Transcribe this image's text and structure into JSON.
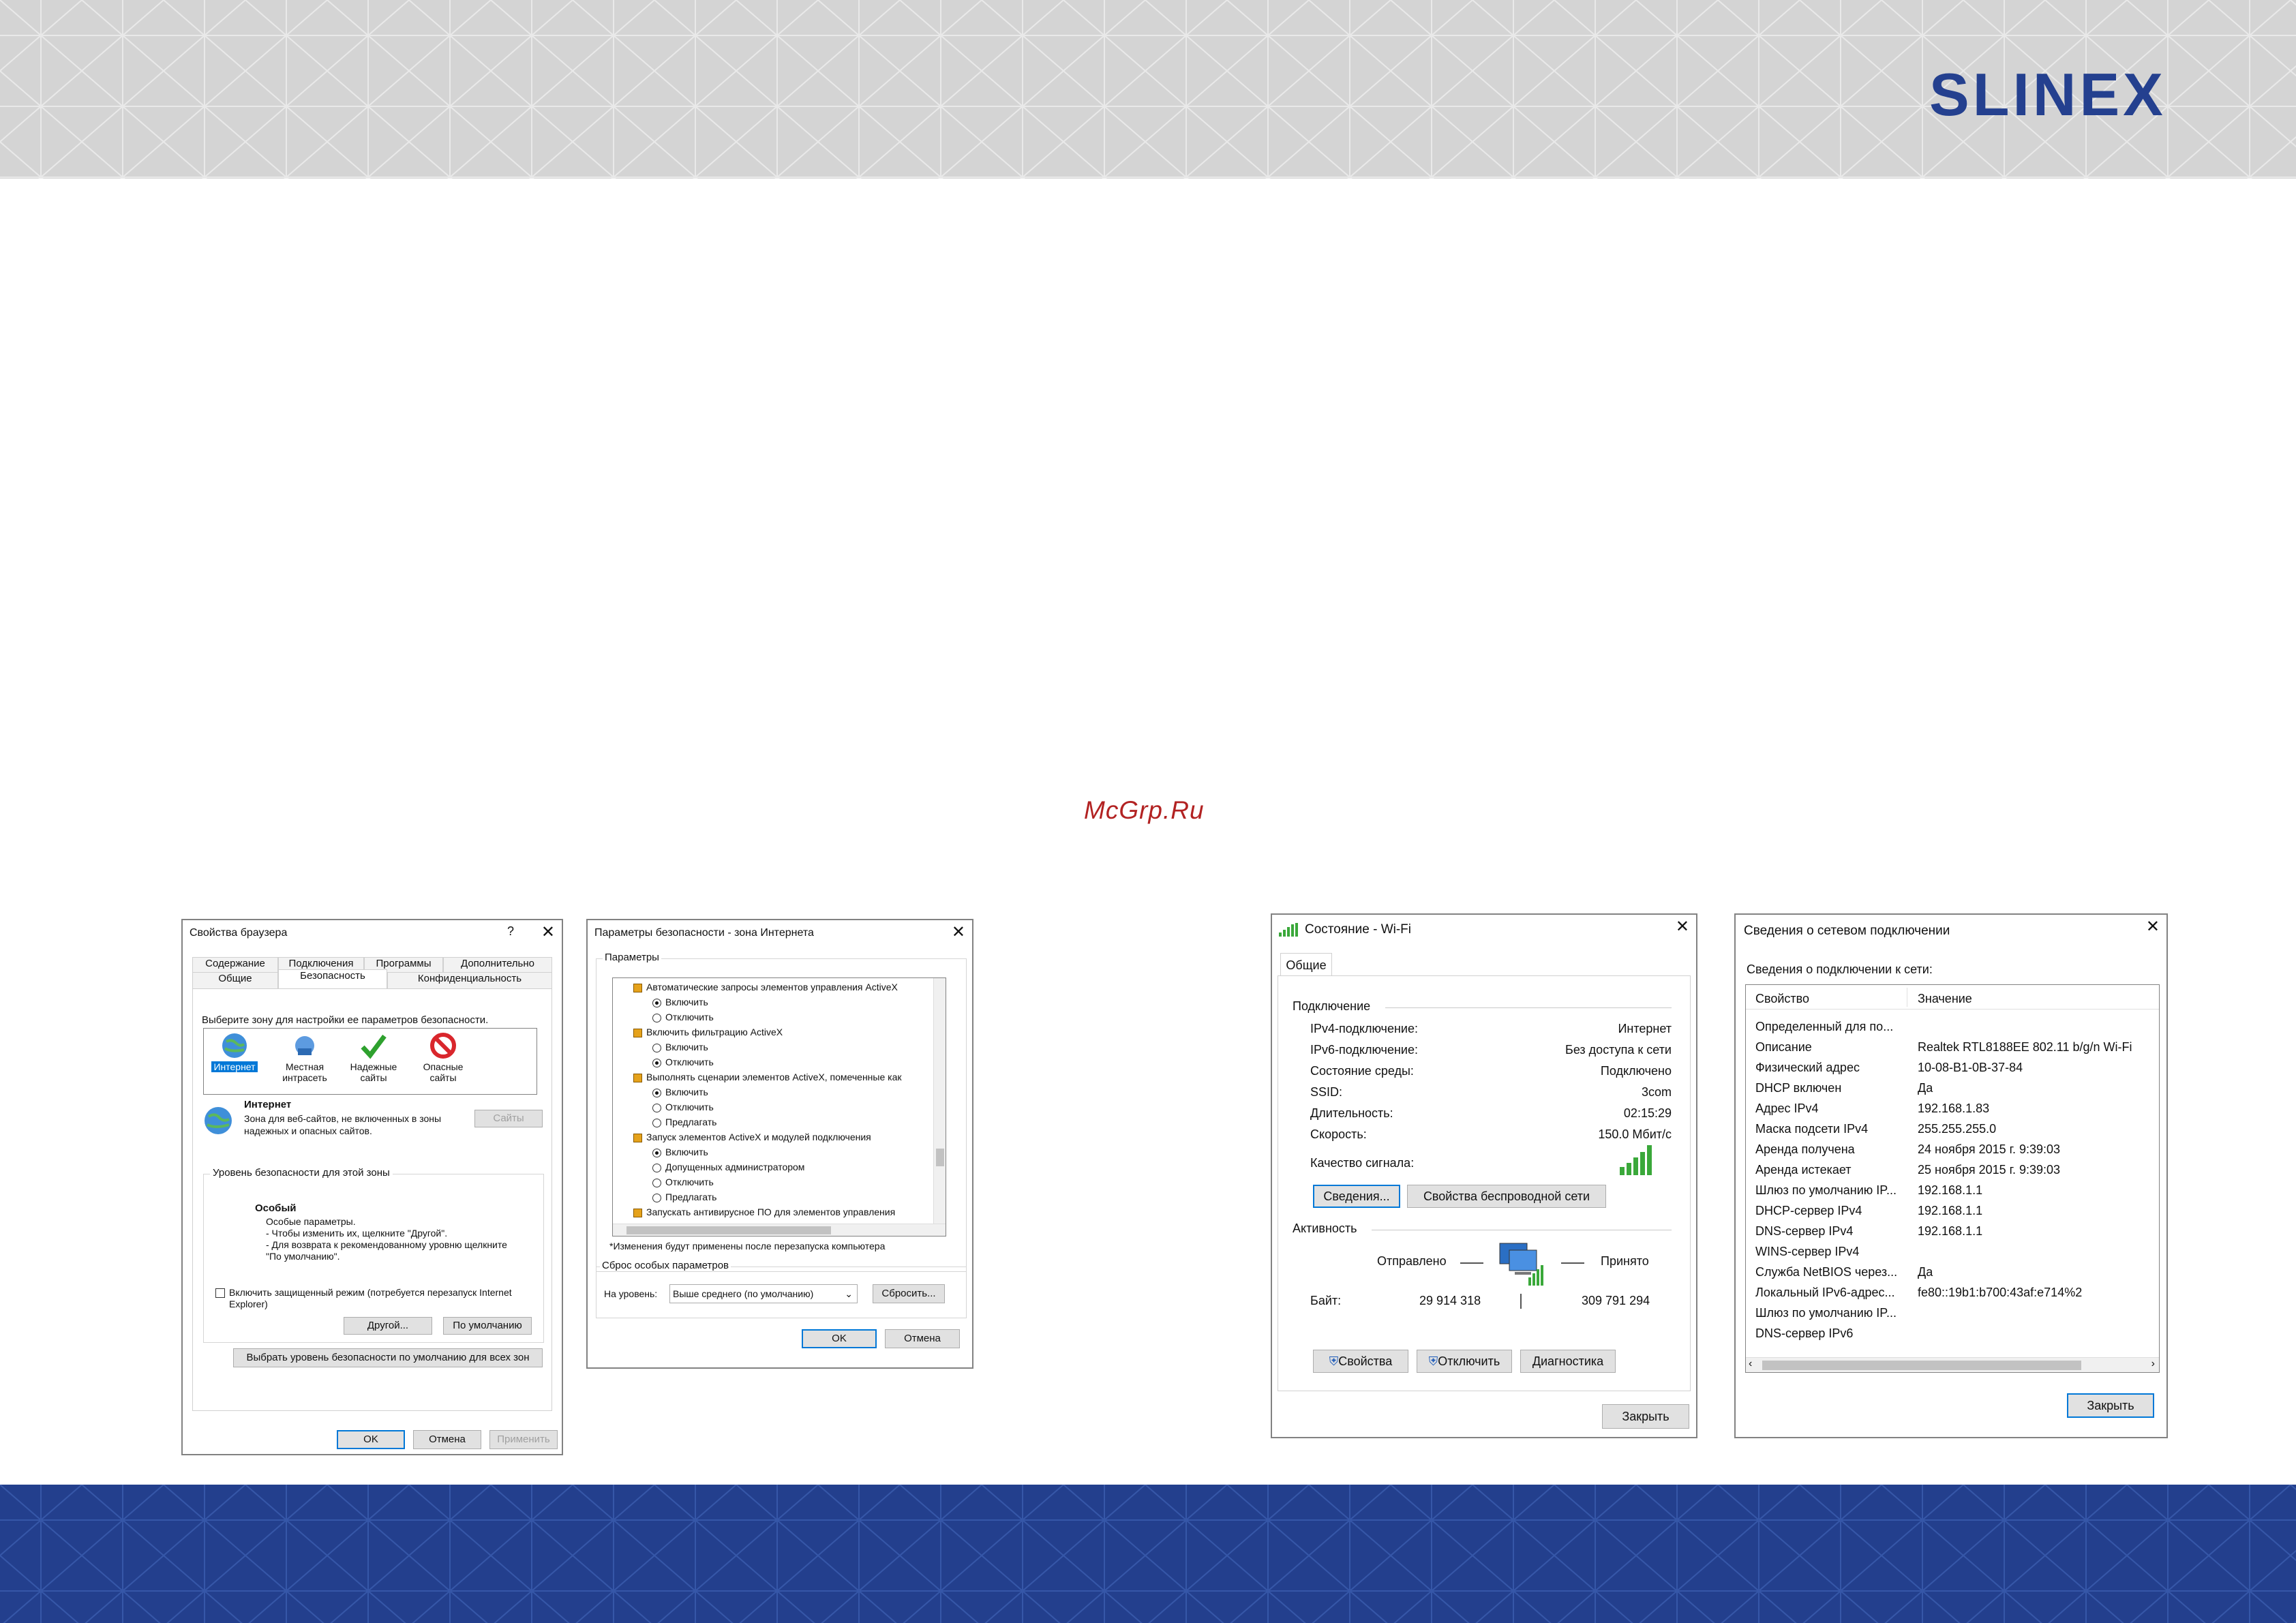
{
  "brand": {
    "logo": "SLINEX",
    "watermark": "McGrp.Ru"
  },
  "win1": {
    "title": "Свойства браузера",
    "help": "?",
    "close": "✕",
    "tabs_top": [
      "Содержание",
      "Подключения",
      "Программы",
      "Дополнительно"
    ],
    "tabs_bottom": [
      "Общие",
      "Безопасность",
      "Конфиденциальность"
    ],
    "zone_prompt": "Выберите зону для настройки ее параметров безопасности.",
    "zones": [
      {
        "label": "Интернет"
      },
      {
        "label": "Местная интрасеть"
      },
      {
        "label": "Надежные сайты"
      },
      {
        "label": "Опасные сайты"
      }
    ],
    "zone_title": "Интернет",
    "zone_desc": "Зона для веб-сайтов, не включенных в зоны надежных и опасных сайтов.",
    "sites_btn": "Сайты",
    "level_group": "Уровень безопасности для этой зоны",
    "level_name": "Особый",
    "level_desc": [
      "Особые параметры.",
      "- Чтобы изменить их, щелкните \"Другой\".",
      "- Для возврата к рекомендованному уровню щелкните \"По умолчанию\"."
    ],
    "protected_mode": "Включить защищенный режим (потребуется перезапуск Internet Explorer)",
    "other_btn": "Другой...",
    "default_btn": "По умолчанию",
    "all_zones_btn": "Выбрать уровень безопасности по умолчанию для всех зон",
    "ok": "OK",
    "cancel": "Отмена",
    "apply": "Применить"
  },
  "win2": {
    "title": "Параметры безопасности - зона Интернета",
    "close": "✕",
    "params": "Параметры",
    "items": [
      {
        "kind": "cat",
        "text": "Автоматические запросы элементов управления ActiveX"
      },
      {
        "kind": "radio",
        "on": true,
        "text": "Включить"
      },
      {
        "kind": "radio",
        "on": false,
        "text": "Отключить"
      },
      {
        "kind": "cat",
        "text": "Включить фильтрацию ActiveX"
      },
      {
        "kind": "radio",
        "on": false,
        "text": "Включить"
      },
      {
        "kind": "radio",
        "on": true,
        "text": "Отключить"
      },
      {
        "kind": "cat",
        "text": "Выполнять сценарии элементов ActiveX, помеченные как"
      },
      {
        "kind": "radio",
        "on": true,
        "text": "Включить"
      },
      {
        "kind": "radio",
        "on": false,
        "text": "Отключить"
      },
      {
        "kind": "radio",
        "on": false,
        "text": "Предлагать"
      },
      {
        "kind": "cat",
        "text": "Запуск элементов ActiveX и модулей подключения"
      },
      {
        "kind": "radio",
        "on": true,
        "text": "Включить"
      },
      {
        "kind": "radio",
        "on": false,
        "text": "Допущенных администратором"
      },
      {
        "kind": "radio",
        "on": false,
        "text": "Отключить"
      },
      {
        "kind": "radio",
        "on": false,
        "text": "Предлагать"
      },
      {
        "kind": "cat",
        "text": "Запускать антивирусное ПО для элементов управления"
      }
    ],
    "note": "*Изменения будут применены после перезапуска компьютера",
    "reset_group": "Сброс особых параметров",
    "level_label": "На уровень:",
    "level_value": "Выше среднего (по умолчанию)",
    "reset_btn": "Сбросить...",
    "ok": "OK",
    "cancel": "Отмена"
  },
  "win3": {
    "title": "Состояние - Wi-Fi",
    "close": "✕",
    "tab": "Общие",
    "conn_group": "Подключение",
    "rows": [
      {
        "k": "IPv4-подключение:",
        "v": "Интернет"
      },
      {
        "k": "IPv6-подключение:",
        "v": "Без доступа к сети"
      },
      {
        "k": "Состояние среды:",
        "v": "Подключено"
      },
      {
        "k": "SSID:",
        "v": "3com"
      },
      {
        "k": "Длительность:",
        "v": "02:15:29"
      },
      {
        "k": "Скорость:",
        "v": "150.0 Мбит/с"
      }
    ],
    "signal": "Качество сигнала:",
    "details_btn": "Сведения...",
    "wireless_btn": "Свойства беспроводной сети",
    "activity_group": "Активность",
    "sent": "Отправлено",
    "received": "Принято",
    "bytes": "Байт:",
    "sent_val": "29 914 318",
    "recv_val": "309 791 294",
    "props_btn": "Свойства",
    "disable_btn": "Отключить",
    "diag_btn": "Диагностика",
    "close_btn": "Закрыть"
  },
  "win4": {
    "title": "Сведения о сетевом подключении",
    "close": "✕",
    "heading": "Сведения о подключении к сети:",
    "col_prop": "Свойство",
    "col_val": "Значение",
    "rows": [
      {
        "k": "Определенный для по...",
        "v": ""
      },
      {
        "k": "Описание",
        "v": "Realtek RTL8188EE 802.11 b/g/n Wi-Fi"
      },
      {
        "k": "Физический адрес",
        "v": "10-08-B1-0B-37-84"
      },
      {
        "k": "DHCP включен",
        "v": "Да"
      },
      {
        "k": "Адрес IPv4",
        "v": "192.168.1.83"
      },
      {
        "k": "Маска подсети IPv4",
        "v": "255.255.255.0"
      },
      {
        "k": "Аренда получена",
        "v": "24 ноября 2015 г. 9:39:03"
      },
      {
        "k": "Аренда истекает",
        "v": "25 ноября 2015 г. 9:39:03"
      },
      {
        "k": "Шлюз по умолчанию IP...",
        "v": "192.168.1.1"
      },
      {
        "k": "DHCP-сервер IPv4",
        "v": "192.168.1.1"
      },
      {
        "k": "DNS-сервер IPv4",
        "v": "192.168.1.1"
      },
      {
        "k": "WINS-сервер IPv4",
        "v": ""
      },
      {
        "k": "Служба NetBIOS через...",
        "v": "Да"
      },
      {
        "k": "Локальный IPv6-адрес...",
        "v": "fe80::19b1:b700:43af:e714%2"
      },
      {
        "k": "Шлюз по умолчанию IP...",
        "v": ""
      },
      {
        "k": "DNS-сервер IPv6",
        "v": ""
      }
    ],
    "close_btn": "Закрыть"
  },
  "colors": {
    "brand_blue": "#24408f",
    "header_gray": "#d4d4d4",
    "footer_blue": "#233f8d",
    "focus_blue": "#0078d7",
    "signal_green": "#3aa83a"
  },
  "icons": [
    "globe-icon",
    "intranet-icon",
    "check-icon",
    "no-entry-icon",
    "network-computer-icon",
    "shield-icon",
    "wifi-signal-icon"
  ]
}
